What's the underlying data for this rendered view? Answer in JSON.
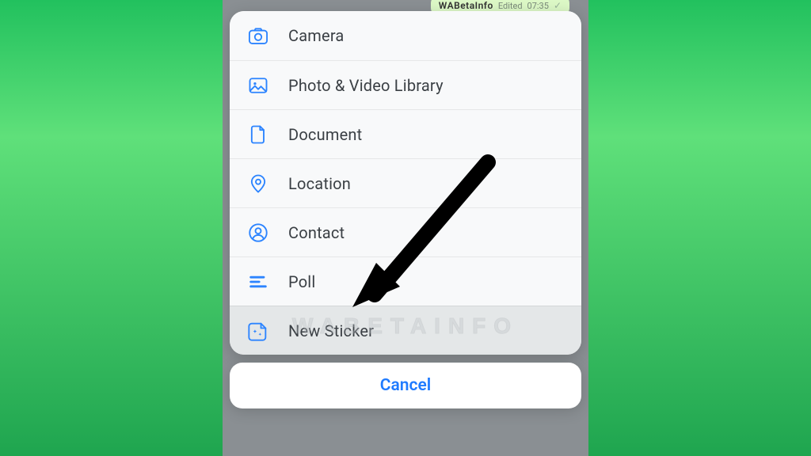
{
  "chat_peek": {
    "source": "WABetaInfo",
    "edited_label": "Edited",
    "time": "07:35"
  },
  "menu_items": [
    {
      "label": "Camera",
      "icon": "camera-icon"
    },
    {
      "label": "Photo & Video Library",
      "icon": "photo-library-icon"
    },
    {
      "label": "Document",
      "icon": "document-icon"
    },
    {
      "label": "Location",
      "icon": "location-icon"
    },
    {
      "label": "Contact",
      "icon": "contact-icon"
    },
    {
      "label": "Poll",
      "icon": "poll-icon"
    },
    {
      "label": "New Sticker",
      "icon": "sticker-icon"
    }
  ],
  "highlighted_index": 6,
  "cancel_label": "Cancel",
  "watermark": "WABETAINFO",
  "colors": {
    "accent": "#2c84ff"
  }
}
